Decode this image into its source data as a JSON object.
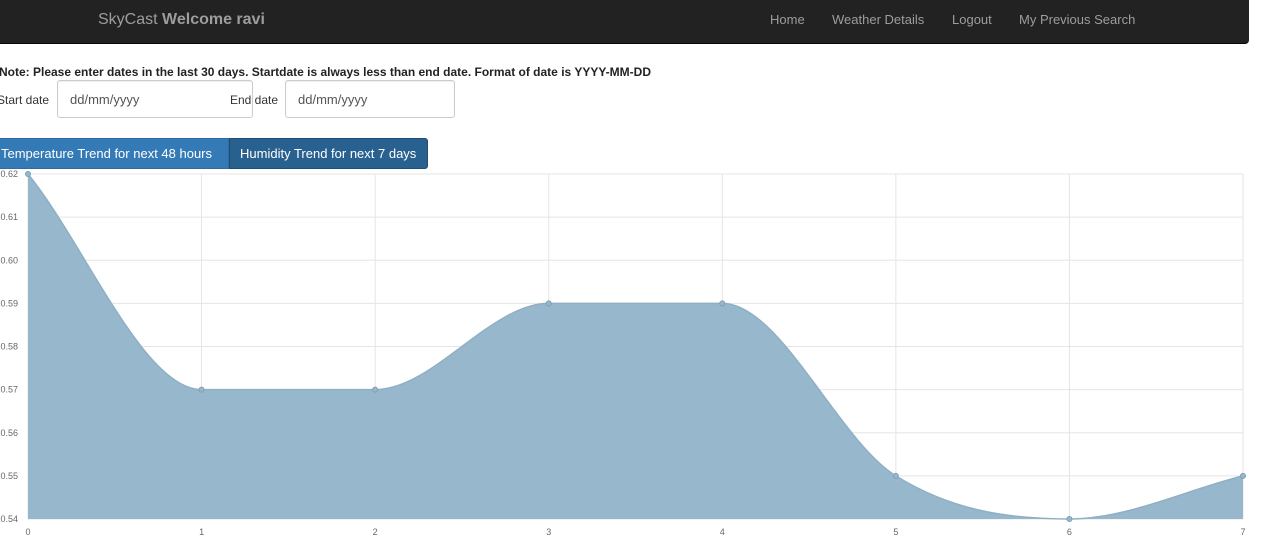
{
  "navbar": {
    "brand_prefix": "SkyCast",
    "brand_welcome": "Welcome ravi",
    "links": [
      "Home",
      "Weather Details",
      "Logout",
      "My Previous Search"
    ]
  },
  "note": "Note: Please enter dates in the last 30 days. Startdate is always less than end date. Format of date is YYYY-MM-DD",
  "form": {
    "start_label": "Start date",
    "start_placeholder": "dd/mm/yyyy",
    "end_label": "End date",
    "end_placeholder": "dd/mm/yyyy"
  },
  "buttons": {
    "temperature": "Temperature Trend for next 48 hours",
    "humidity": "Humidity Trend for next 7 days"
  },
  "colors": {
    "navbar_bg": "#222222",
    "button_primary": "#337ab7",
    "area_fill": "#97b8cc",
    "area_stroke": "#8fb0c4"
  },
  "chart_data": {
    "type": "area",
    "x": [
      0,
      1,
      2,
      3,
      4,
      5,
      6,
      7
    ],
    "values": [
      0.62,
      0.57,
      0.57,
      0.59,
      0.59,
      0.55,
      0.54,
      0.55
    ],
    "y_ticks": [
      "0.54",
      "0.55",
      "0.56",
      "0.57",
      "0.58",
      "0.59",
      "0.60",
      "0.61",
      "0.62"
    ],
    "x_ticks": [
      "0",
      "1",
      "2",
      "3",
      "4",
      "5",
      "6",
      "7"
    ],
    "ylim": [
      0.54,
      0.62
    ],
    "xlim": [
      0,
      7
    ],
    "grid": true,
    "legend": "none"
  }
}
